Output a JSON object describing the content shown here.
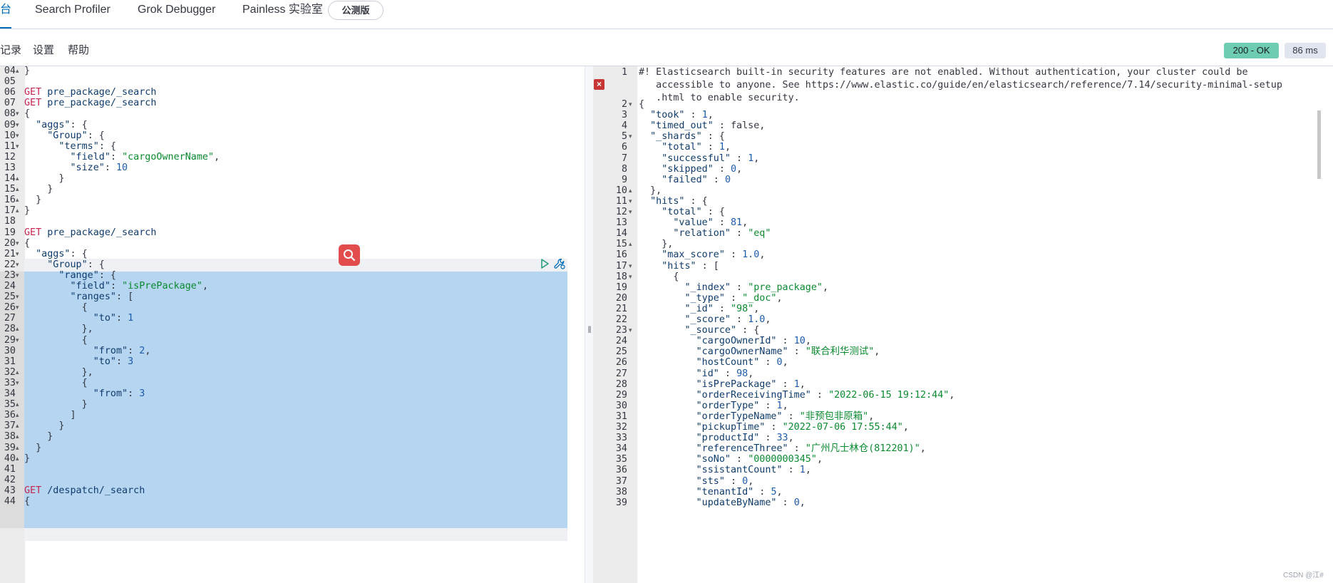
{
  "topbar": {
    "tabs": [
      {
        "label": "台",
        "selected": true
      },
      {
        "label": "Search Profiler",
        "selected": false
      },
      {
        "label": "Grok Debugger",
        "selected": false
      },
      {
        "label": "Painless 实验室",
        "selected": false
      }
    ],
    "beta_label": "公测版"
  },
  "menu": {
    "items": [
      "记录",
      "设置",
      "帮助"
    ]
  },
  "response_status": {
    "code": "200 - OK",
    "time": "86 ms"
  },
  "colors": {
    "accent": "#006bb8",
    "ok": "#6dccb1",
    "method": "#c7254e",
    "string": "#0a8a2f",
    "number": "#1d5bab",
    "selection": "#b5d5f0"
  },
  "left_editor": {
    "lines": [
      {
        "n": "04",
        "fold": "up",
        "code": "}"
      },
      {
        "n": "05",
        "fold": "",
        "code": ""
      },
      {
        "n": "06",
        "fold": "",
        "code": "GET pre_package/_search"
      },
      {
        "n": "07",
        "fold": "",
        "code": "GET pre_package/_search"
      },
      {
        "n": "08",
        "fold": "down",
        "code": "{"
      },
      {
        "n": "09",
        "fold": "down",
        "code": "  \"aggs\": {"
      },
      {
        "n": "10",
        "fold": "down",
        "code": "    \"Group\": {"
      },
      {
        "n": "11",
        "fold": "down",
        "code": "      \"terms\": {"
      },
      {
        "n": "12",
        "fold": "",
        "code": "        \"field\": \"cargoOwnerName\","
      },
      {
        "n": "13",
        "fold": "",
        "code": "        \"size\": 10"
      },
      {
        "n": "14",
        "fold": "up",
        "code": "      }"
      },
      {
        "n": "15",
        "fold": "up",
        "code": "    }"
      },
      {
        "n": "16",
        "fold": "up",
        "code": "  }"
      },
      {
        "n": "17",
        "fold": "up",
        "code": "}"
      },
      {
        "n": "18",
        "fold": "",
        "code": ""
      },
      {
        "n": "19",
        "fold": "",
        "code": "GET pre_package/_search"
      },
      {
        "n": "20",
        "fold": "down",
        "code": "{"
      },
      {
        "n": "21",
        "fold": "down",
        "code": "  \"aggs\": {"
      },
      {
        "n": "22",
        "fold": "down",
        "code": "    \"Group\": {"
      },
      {
        "n": "23",
        "fold": "down",
        "code": "      \"range\": {"
      },
      {
        "n": "24",
        "fold": "",
        "code": "        \"field\": \"isPrePackage\","
      },
      {
        "n": "25",
        "fold": "down",
        "code": "        \"ranges\": ["
      },
      {
        "n": "26",
        "fold": "down",
        "code": "          {"
      },
      {
        "n": "27",
        "fold": "",
        "code": "            \"to\": 1"
      },
      {
        "n": "28",
        "fold": "up",
        "code": "          },"
      },
      {
        "n": "29",
        "fold": "down",
        "code": "          {"
      },
      {
        "n": "30",
        "fold": "",
        "code": "            \"from\": 2,"
      },
      {
        "n": "31",
        "fold": "",
        "code": "            \"to\": 3"
      },
      {
        "n": "32",
        "fold": "up",
        "code": "          },"
      },
      {
        "n": "33",
        "fold": "down",
        "code": "          {"
      },
      {
        "n": "34",
        "fold": "",
        "code": "            \"from\": 3"
      },
      {
        "n": "35",
        "fold": "up",
        "code": "          }"
      },
      {
        "n": "36",
        "fold": "up",
        "code": "        ]"
      },
      {
        "n": "37",
        "fold": "up",
        "code": "      }"
      },
      {
        "n": "38",
        "fold": "up",
        "code": "    }"
      },
      {
        "n": "39",
        "fold": "up",
        "code": "  }"
      },
      {
        "n": "40",
        "fold": "up",
        "code": "}"
      },
      {
        "n": "41",
        "fold": "",
        "code": ""
      },
      {
        "n": "42",
        "fold": "",
        "code": ""
      },
      {
        "n": "43",
        "fold": "",
        "code": "GET /despatch/_search"
      },
      {
        "n": "44",
        "fold": "",
        "code": "{"
      }
    ]
  },
  "right_editor": {
    "comment_lines": [
      "#! Elasticsearch built-in security features are not enabled. Without authentication, your cluster could be",
      "   accessible to anyone. See https://www.elastic.co/guide/en/elasticsearch/reference/7.14/security-minimal-setup",
      "   .html to enable security."
    ],
    "lines": [
      {
        "n": "2",
        "fold": "down",
        "code": "{"
      },
      {
        "n": "3",
        "fold": "",
        "code": "  \"took\" : 1,"
      },
      {
        "n": "4",
        "fold": "",
        "code": "  \"timed_out\" : false,"
      },
      {
        "n": "5",
        "fold": "down",
        "code": "  \"_shards\" : {"
      },
      {
        "n": "6",
        "fold": "",
        "code": "    \"total\" : 1,"
      },
      {
        "n": "7",
        "fold": "",
        "code": "    \"successful\" : 1,"
      },
      {
        "n": "8",
        "fold": "",
        "code": "    \"skipped\" : 0,"
      },
      {
        "n": "9",
        "fold": "",
        "code": "    \"failed\" : 0"
      },
      {
        "n": "10",
        "fold": "up",
        "code": "  },"
      },
      {
        "n": "11",
        "fold": "down",
        "code": "  \"hits\" : {"
      },
      {
        "n": "12",
        "fold": "down",
        "code": "    \"total\" : {"
      },
      {
        "n": "13",
        "fold": "",
        "code": "      \"value\" : 81,"
      },
      {
        "n": "14",
        "fold": "",
        "code": "      \"relation\" : \"eq\""
      },
      {
        "n": "15",
        "fold": "up",
        "code": "    },"
      },
      {
        "n": "16",
        "fold": "",
        "code": "    \"max_score\" : 1.0,"
      },
      {
        "n": "17",
        "fold": "down",
        "code": "    \"hits\" : ["
      },
      {
        "n": "18",
        "fold": "down",
        "code": "      {"
      },
      {
        "n": "19",
        "fold": "",
        "code": "        \"_index\" : \"pre_package\","
      },
      {
        "n": "20",
        "fold": "",
        "code": "        \"_type\" : \"_doc\","
      },
      {
        "n": "21",
        "fold": "",
        "code": "        \"_id\" : \"98\","
      },
      {
        "n": "22",
        "fold": "",
        "code": "        \"_score\" : 1.0,"
      },
      {
        "n": "23",
        "fold": "down",
        "code": "        \"_source\" : {"
      },
      {
        "n": "24",
        "fold": "",
        "code": "          \"cargoOwnerId\" : 10,"
      },
      {
        "n": "25",
        "fold": "",
        "code": "          \"cargoOwnerName\" : \"联合利华测试\","
      },
      {
        "n": "26",
        "fold": "",
        "code": "          \"hostCount\" : 0,"
      },
      {
        "n": "27",
        "fold": "",
        "code": "          \"id\" : 98,"
      },
      {
        "n": "28",
        "fold": "",
        "code": "          \"isPrePackage\" : 1,"
      },
      {
        "n": "29",
        "fold": "",
        "code": "          \"orderReceivingTime\" : \"2022-06-15 19:12:44\","
      },
      {
        "n": "30",
        "fold": "",
        "code": "          \"orderType\" : 1,"
      },
      {
        "n": "31",
        "fold": "",
        "code": "          \"orderTypeName\" : \"非预包非原箱\","
      },
      {
        "n": "32",
        "fold": "",
        "code": "          \"pickupTime\" : \"2022-07-06 17:55:44\","
      },
      {
        "n": "33",
        "fold": "",
        "code": "          \"productId\" : 33,"
      },
      {
        "n": "34",
        "fold": "",
        "code": "          \"referenceThree\" : \"广州凡士林仓(812201)\","
      },
      {
        "n": "35",
        "fold": "",
        "code": "          \"soNo\" : \"0000000345\","
      },
      {
        "n": "36",
        "fold": "",
        "code": "          \"ssistantCount\" : 1,"
      },
      {
        "n": "37",
        "fold": "",
        "code": "          \"sts\" : 0,"
      },
      {
        "n": "38",
        "fold": "",
        "code": "          \"tenantId\" : 5,"
      },
      {
        "n": "39",
        "fold": "",
        "code": "          \"updateByName\" : 0,"
      }
    ]
  },
  "watermark": "CSDN @江#"
}
